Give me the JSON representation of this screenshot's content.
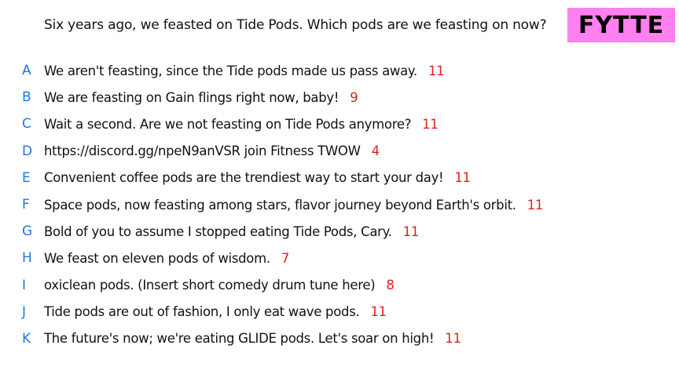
{
  "question": "Six years ago, we feasted on Tide Pods. Which pods are we feasting on now?",
  "badge": "FYTTE",
  "colors": {
    "letter": "#2277dd",
    "count": "#e0201a",
    "badge_bg": "#ff80ee"
  },
  "responses": [
    {
      "letter": "A",
      "text": "We aren't feasting, since the Tide pods made us pass away.",
      "count": "11"
    },
    {
      "letter": "B",
      "text": "We are feasting on Gain flings right now, baby!",
      "count": "9"
    },
    {
      "letter": "C",
      "text": "Wait a second. Are we not feasting on Tide Pods anymore?",
      "count": "11"
    },
    {
      "letter": "D",
      "text": "https://discord.gg/npeN9anVSR join Fitness TWOW",
      "count": "4"
    },
    {
      "letter": "E",
      "text": "Convenient coffee pods are the trendiest way to start your day!",
      "count": "11"
    },
    {
      "letter": "F",
      "text": "Space pods, now feasting among stars, flavor journey beyond Earth's orbit.",
      "count": "11"
    },
    {
      "letter": "G",
      "text": "Bold of you to assume I stopped eating Tide Pods, Cary.",
      "count": "11"
    },
    {
      "letter": "H",
      "text": "We feast on eleven pods of wisdom.",
      "count": "7"
    },
    {
      "letter": "I",
      "text": "oxiclean pods. (Insert short comedy drum tune here)",
      "count": "8"
    },
    {
      "letter": "J",
      "text": "Tide pods are out of fashion, I only eat wave pods.",
      "count": "11"
    },
    {
      "letter": "K",
      "text": "The future's now; we're eating GLIDE pods. Let's soar on high!",
      "count": "11"
    }
  ]
}
